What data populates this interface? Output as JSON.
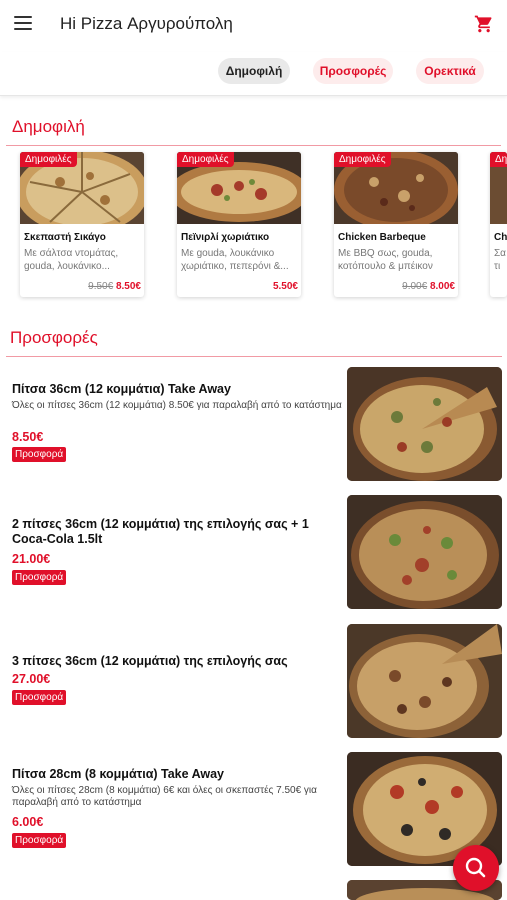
{
  "header": {
    "title": "Hi Pizza Αργυρούπολη",
    "menu_icon": "hamburger-menu-icon",
    "cart_icon": "shopping-cart-icon",
    "accent_color": "#e0102a"
  },
  "categories": {
    "chips": [
      {
        "label": "Δημοφιλή",
        "selected": true
      },
      {
        "label": "Προσφορές",
        "selected": false
      },
      {
        "label": "Ορεκτικά",
        "selected": false
      }
    ]
  },
  "popular": {
    "title": "Δημοφιλή",
    "items": [
      {
        "badge": "Δημοφιλές",
        "name": "Σκεπαστή Σικάγο",
        "desc": "Με σάλτσα ντομάτας, gouda, λουκάνικο...",
        "old_price": "9.50€",
        "price": "8.50€"
      },
      {
        "badge": "Δημοφιλές",
        "name": "Πεϊνιρλί χωριάτικο",
        "desc": "Με gouda, λουκάνικο χωριάτικο, πεπερόνι &...",
        "old_price": "",
        "price": "5.50€"
      },
      {
        "badge": "Δημοφιλές",
        "name": "Chicken Barbeque",
        "desc": "Με BBQ σως, gouda, κοτόπουλο & μπέικον",
        "old_price": "9.00€",
        "price": "8.00€"
      },
      {
        "badge": "Δημοφιλές",
        "name": "Ch",
        "desc": "Σα τι",
        "old_price": "",
        "price": ""
      }
    ]
  },
  "offers": {
    "title": "Προσφορές",
    "items": [
      {
        "title": "Πίτσα 36cm (12 κομμάτια) Take Away",
        "desc": "Όλες οι πίτσες 36cm (12 κομμάτια) 8.50€ για παραλαβή από το κατάστημα",
        "price": "8.50€",
        "tag": "Προσφορά"
      },
      {
        "title": "2 πίτσες 36cm (12 κομμάτια) της επιλογής σας + 1 Coca-Cola 1.5lt",
        "desc": "",
        "price": "21.00€",
        "tag": "Προσφορά"
      },
      {
        "title": "3 πίτσες 36cm (12 κομμάτια) της επιλογής σας",
        "desc": "",
        "price": "27.00€",
        "tag": "Προσφορά"
      },
      {
        "title": "Πίτσα 28cm (8 κομμάτια) Take Away",
        "desc": "Όλες οι πίτσες 28cm (8 κομμάτια) 6€ και όλες οι σκεπαστές 7.50€ για παραλαβή από το κατάστημα",
        "price": "6.00€",
        "tag": "Προσφορά"
      }
    ]
  },
  "fab": {
    "icon": "search-icon"
  }
}
